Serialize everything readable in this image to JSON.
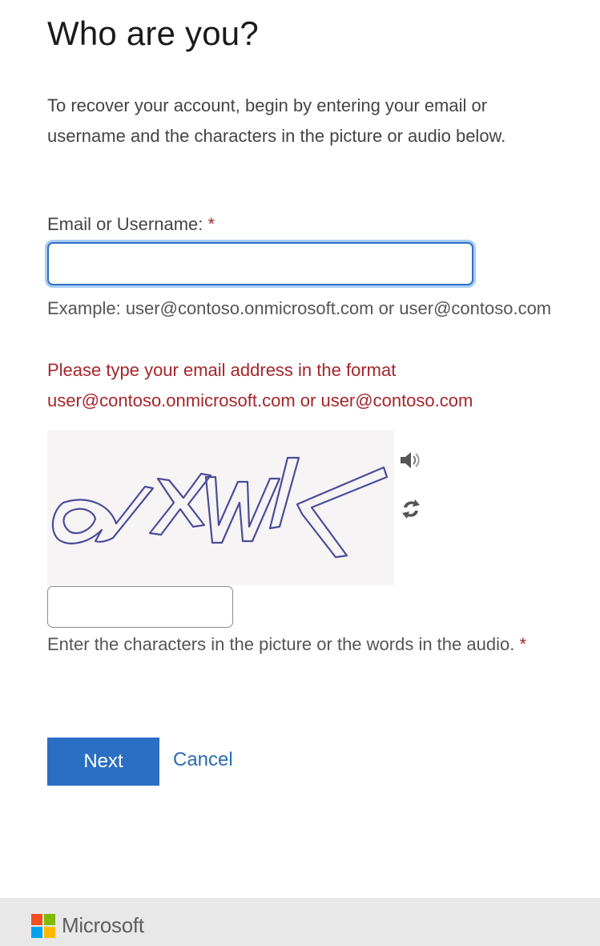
{
  "page": {
    "title": "Who are you?",
    "intro": "To recover your account, begin by entering your email or username and the characters in the picture or audio below."
  },
  "email_field": {
    "label": "Email or Username:",
    "required_marker": "*",
    "value": "",
    "placeholder": "",
    "example": "Example: user@contoso.onmicrosoft.com or user@contoso.com",
    "error": "Please type your email address in the format user@contoso.onmicrosoft.com or user@contoso.com"
  },
  "captcha": {
    "text": "dXWK",
    "audio_icon": "speaker-icon",
    "refresh_icon": "refresh-icon",
    "input_value": "",
    "hint": "Enter the characters in the picture or the words in the audio.",
    "required_marker": "*"
  },
  "actions": {
    "next_label": "Next",
    "cancel_label": "Cancel"
  },
  "footer": {
    "brand": "Microsoft"
  },
  "colors": {
    "accent": "#2a6fc3",
    "error": "#a4262c",
    "link": "#2b6cb3",
    "ms_red": "#f25022",
    "ms_green": "#7fba00",
    "ms_blue": "#00a4ef",
    "ms_yellow": "#ffb900"
  }
}
